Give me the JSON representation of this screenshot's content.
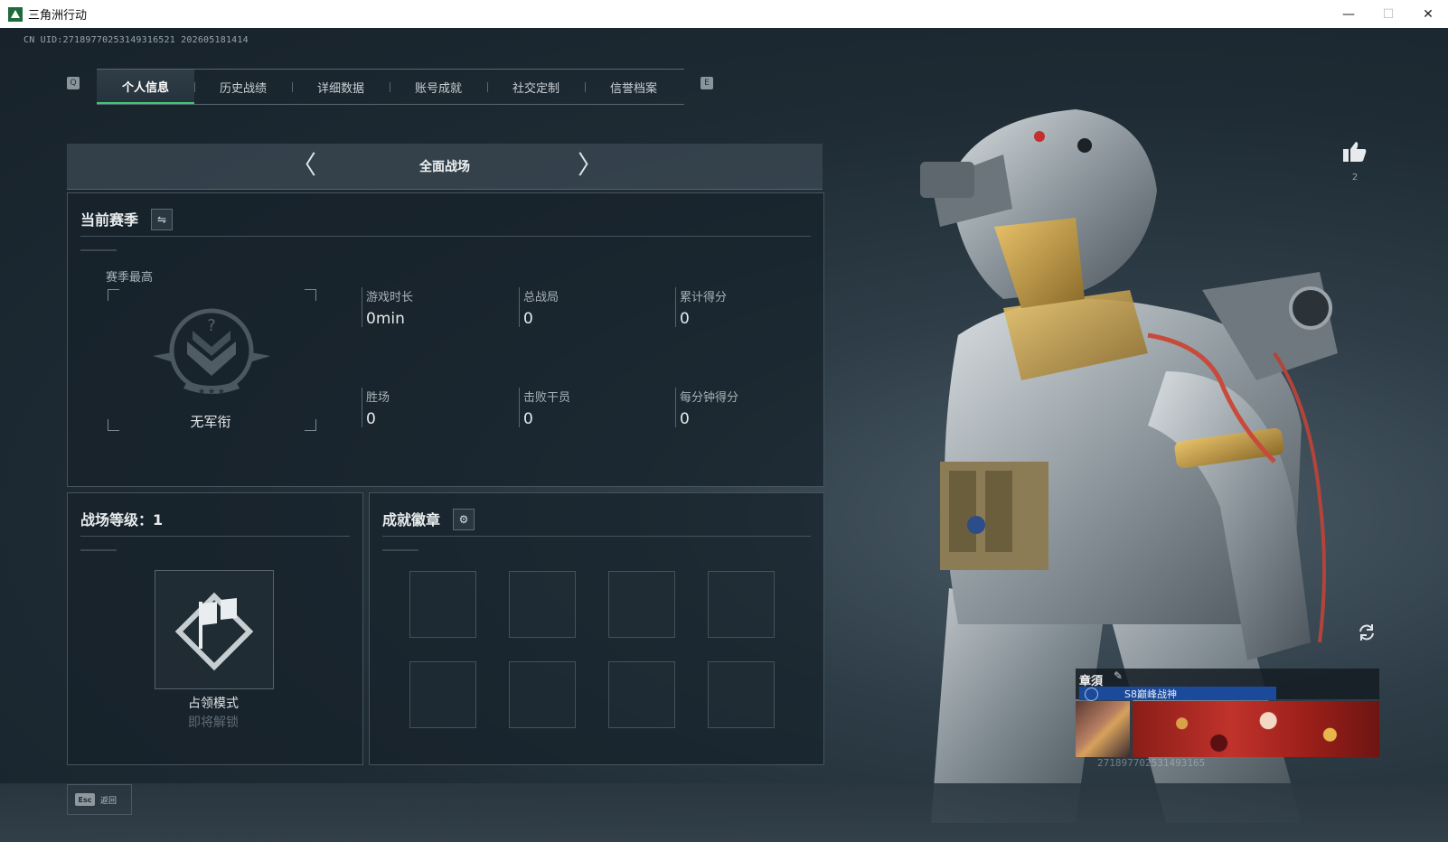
{
  "window": {
    "title": "三角洲行动",
    "min_glyph": "—",
    "max_glyph": "☐",
    "close_glyph": "✕"
  },
  "header": {
    "uid": "CN UID:271897702531493165​21 202605181414",
    "bg_title": "",
    "key_left": "Q",
    "key_right": "E"
  },
  "tabs": [
    {
      "label": "个人信息",
      "active": true
    },
    {
      "label": "历史战绩",
      "active": false
    },
    {
      "label": "详细数据",
      "active": false
    },
    {
      "label": "账号成就",
      "active": false
    },
    {
      "label": "社交定制",
      "active": false
    },
    {
      "label": "信誉档案",
      "active": false
    }
  ],
  "mode_selector": {
    "title": "全面战场",
    "prev_glyph": "〈",
    "next_glyph": "〉"
  },
  "season": {
    "title": "当前赛季",
    "switch_glyph": "⇋",
    "best_label": "赛季最高",
    "rank": "无军衔",
    "stats": [
      {
        "label": "游戏时长",
        "value": "0min"
      },
      {
        "label": "总战局",
        "value": "0"
      },
      {
        "label": "累计得分",
        "value": "0"
      },
      {
        "label": "胜场",
        "value": "0"
      },
      {
        "label": "击败干员",
        "value": "0"
      },
      {
        "label": "每分钟得分",
        "value": "0"
      }
    ]
  },
  "level": {
    "title": "战场等级：1",
    "mode_name": "占领模式",
    "mode_status": "即将解锁"
  },
  "badges": {
    "title": "成就徽章",
    "settings_glyph": "⚙",
    "slots": 8
  },
  "likes": {
    "count": "2"
  },
  "player_card": {
    "name": "章須",
    "edit_glyph": "✎",
    "title_text": "S8巅峰战神",
    "uid": "271897702531493165"
  },
  "footer": {
    "esc_key": "Esc",
    "esc_label": "返回"
  },
  "colors": {
    "accent_green": "#3ec87a",
    "title_bar_blue": "#1b4a9b"
  }
}
